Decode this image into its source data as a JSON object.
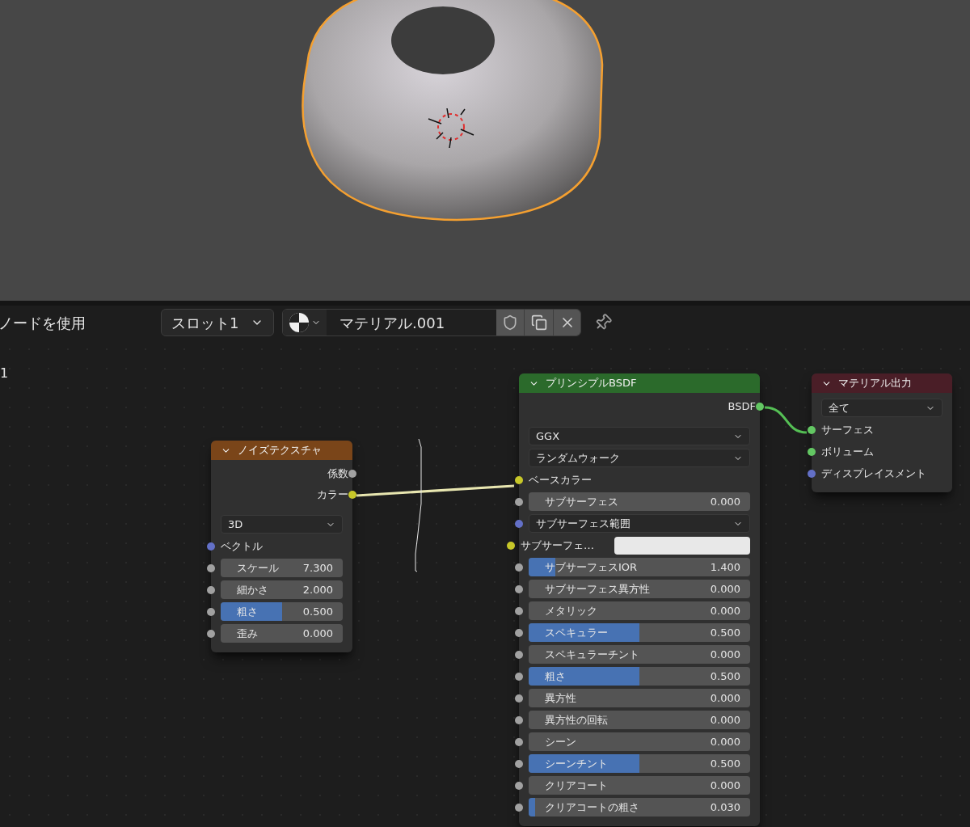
{
  "header": {
    "label": "ノードを使用",
    "slot": "スロット1",
    "material_name": "マテリアル.001"
  },
  "canvas_label": "1",
  "nodes": [
    {
      "kind": "noise",
      "title": "ノイズテクスチャ",
      "color": "#7a4519",
      "outputs": [
        {
          "label": "係数",
          "color": "#a1a1a1"
        },
        {
          "label": "カラー",
          "color": "#c7c729"
        }
      ],
      "rows": [
        {
          "kind": "dropdown",
          "value": "3D"
        },
        {
          "kind": "input",
          "label": "ベクトル",
          "color": "#6370c7"
        },
        {
          "kind": "number",
          "label": "スケール",
          "value": "7.300",
          "color": "#a1a1a1"
        },
        {
          "kind": "number",
          "label": "細かさ",
          "value": "2.000",
          "color": "#a1a1a1"
        },
        {
          "kind": "slider",
          "label": "粗さ",
          "value": "0.500",
          "level": 0.5,
          "color": "#a1a1a1"
        },
        {
          "kind": "number",
          "label": "歪み",
          "value": "0.000",
          "color": "#a1a1a1"
        }
      ]
    },
    {
      "kind": "principled",
      "title": "プリンシプルBSDF",
      "color": "#2b6a2b",
      "outputs": [
        {
          "label": "BSDF",
          "color": "#63c763"
        }
      ],
      "rows": [
        {
          "kind": "dropdown",
          "value": "GGX"
        },
        {
          "kind": "dropdown",
          "value": "ランダムウォーク"
        },
        {
          "kind": "input",
          "label": "ベースカラー",
          "color": "#c7c729"
        },
        {
          "kind": "slider",
          "label": "サブサーフェス",
          "value": "0.000",
          "level": 0,
          "color": "#a1a1a1"
        },
        {
          "kind": "dropdown",
          "value": "サブサーフェス範囲",
          "color": "#6370c7"
        },
        {
          "kind": "swatch",
          "label": "サブサーフェ…",
          "color": "#c7c729"
        },
        {
          "kind": "slider",
          "label": "サブサーフェスIOR",
          "value": "1.400",
          "level": 0.12,
          "color": "#a1a1a1"
        },
        {
          "kind": "slider",
          "label": "サブサーフェス異方性",
          "value": "0.000",
          "level": 0,
          "color": "#a1a1a1"
        },
        {
          "kind": "slider",
          "label": "メタリック",
          "value": "0.000",
          "level": 0,
          "color": "#a1a1a1"
        },
        {
          "kind": "slider",
          "label": "スペキュラー",
          "value": "0.500",
          "level": 0.5,
          "color": "#a1a1a1"
        },
        {
          "kind": "slider",
          "label": "スペキュラーチント",
          "value": "0.000",
          "level": 0,
          "color": "#a1a1a1"
        },
        {
          "kind": "slider",
          "label": "粗さ",
          "value": "0.500",
          "level": 0.5,
          "color": "#a1a1a1"
        },
        {
          "kind": "slider",
          "label": "異方性",
          "value": "0.000",
          "level": 0,
          "color": "#a1a1a1"
        },
        {
          "kind": "slider",
          "label": "異方性の回転",
          "value": "0.000",
          "level": 0,
          "color": "#a1a1a1"
        },
        {
          "kind": "slider",
          "label": "シーン",
          "value": "0.000",
          "level": 0,
          "color": "#a1a1a1"
        },
        {
          "kind": "slider",
          "label": "シーンチント",
          "value": "0.500",
          "level": 0.5,
          "color": "#a1a1a1"
        },
        {
          "kind": "slider",
          "label": "クリアコート",
          "value": "0.000",
          "level": 0,
          "color": "#a1a1a1"
        },
        {
          "kind": "slider",
          "label": "クリアコートの粗さ",
          "value": "0.030",
          "level": 0.03,
          "color": "#a1a1a1"
        }
      ]
    },
    {
      "kind": "output",
      "title": "マテリアル出力",
      "color": "#4a1e27",
      "rows": [
        {
          "kind": "dropdown",
          "value": "全て"
        },
        {
          "kind": "input",
          "label": "サーフェス",
          "color": "#63c763"
        },
        {
          "kind": "input",
          "label": "ボリューム",
          "color": "#63c763"
        },
        {
          "kind": "input",
          "label": "ディスプレイスメント",
          "color": "#6370c7"
        }
      ]
    }
  ]
}
